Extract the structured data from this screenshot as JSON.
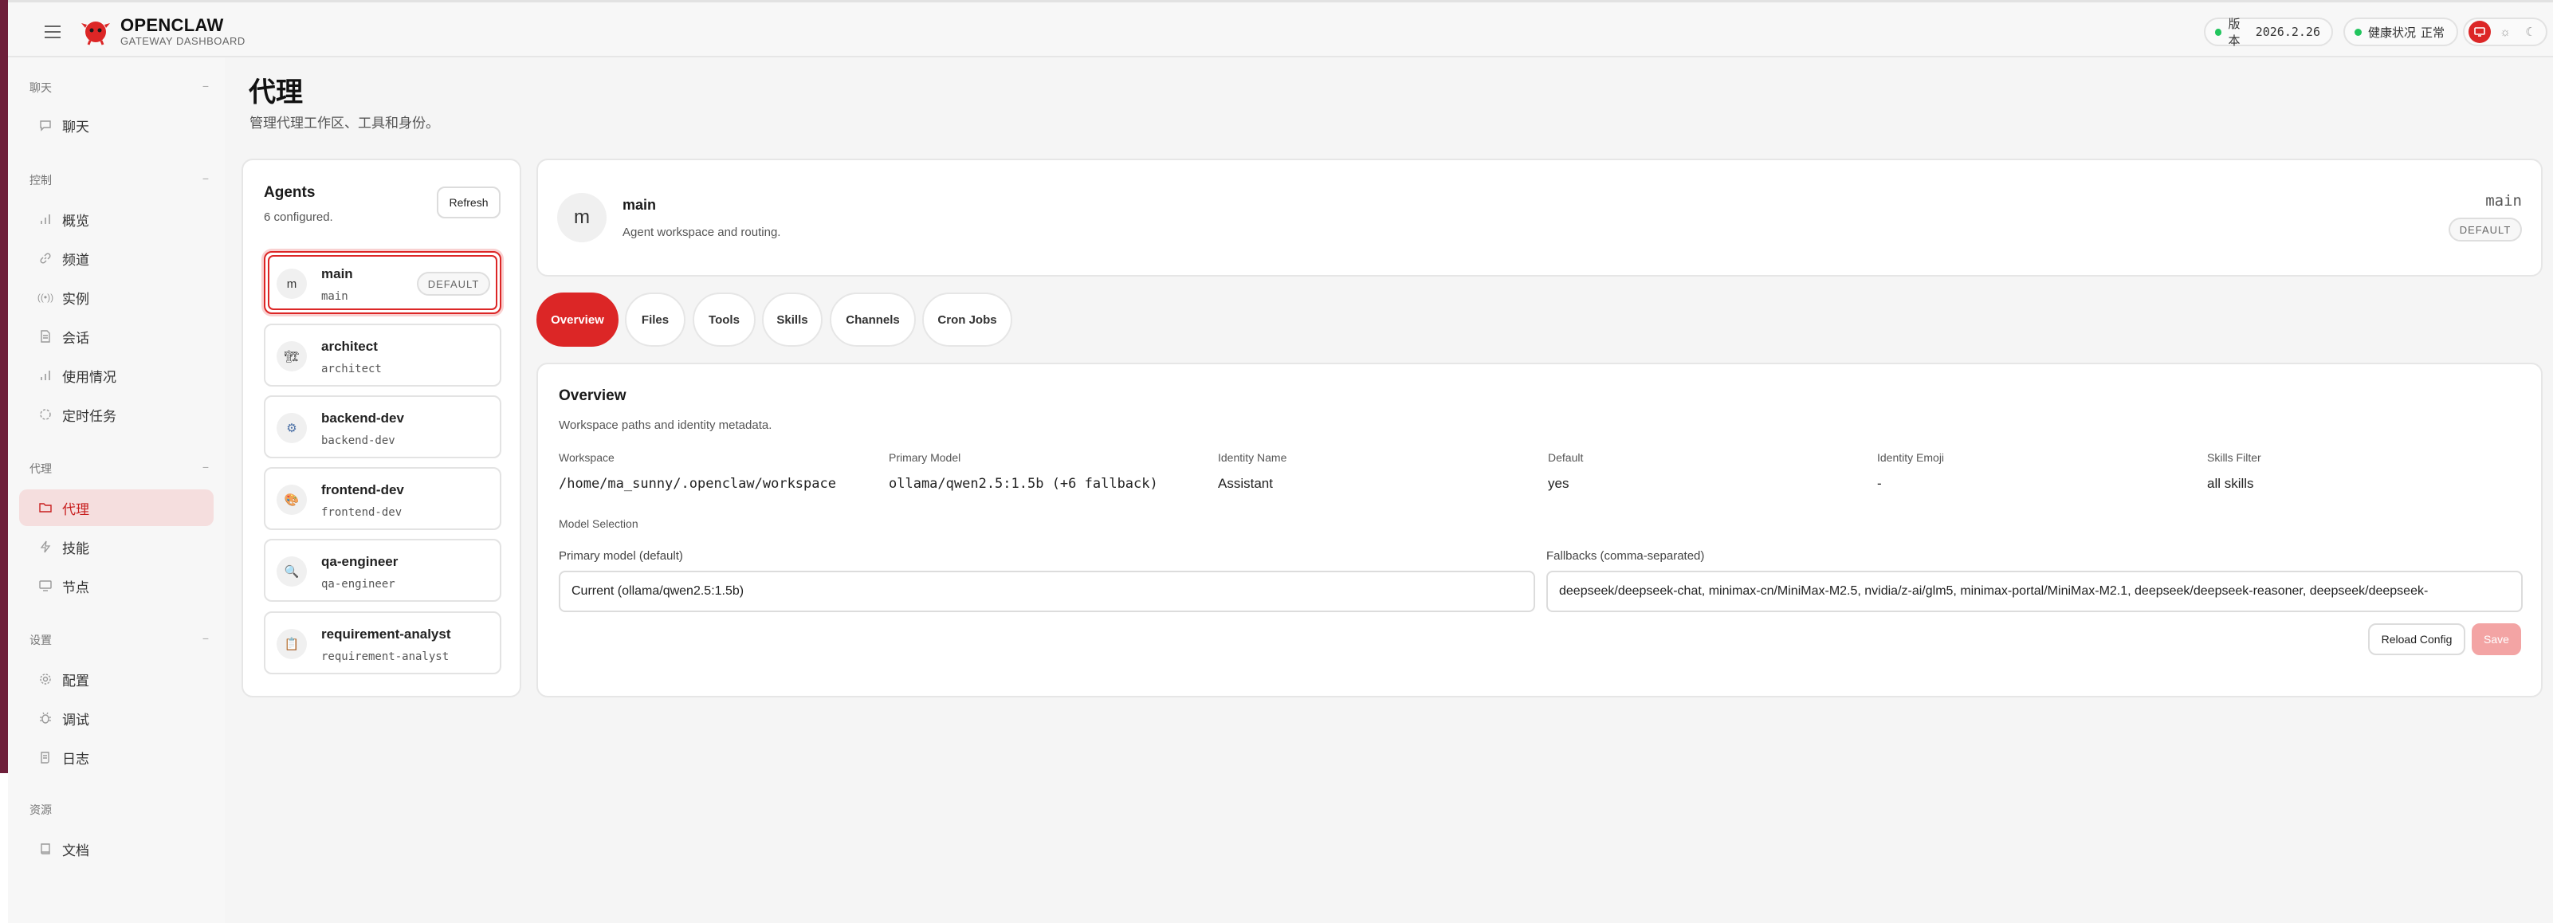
{
  "brand": {
    "name": "OPENCLAW",
    "subtitle": "GATEWAY DASHBOARD"
  },
  "topbar": {
    "version_label": "版本",
    "version_value": "2026.2.26",
    "health_label": "健康状况",
    "health_value": "正常",
    "status_color": "#22c55e",
    "accent_color": "#dc2626"
  },
  "sidebar": {
    "sections": [
      {
        "title": "聊天",
        "items": [
          {
            "label": "聊天",
            "icon": "chat-icon"
          }
        ]
      },
      {
        "title": "控制",
        "items": [
          {
            "label": "概览",
            "icon": "bar-chart-icon"
          },
          {
            "label": "频道",
            "icon": "link-icon"
          },
          {
            "label": "实例",
            "icon": "radio-icon"
          },
          {
            "label": "会话",
            "icon": "document-icon"
          },
          {
            "label": "使用情况",
            "icon": "bar-chart-icon"
          },
          {
            "label": "定时任务",
            "icon": "loader-icon"
          }
        ]
      },
      {
        "title": "代理",
        "items": [
          {
            "label": "代理",
            "icon": "folder-icon",
            "active": true
          },
          {
            "label": "技能",
            "icon": "zap-icon"
          },
          {
            "label": "节点",
            "icon": "monitor-icon"
          }
        ]
      },
      {
        "title": "设置",
        "items": [
          {
            "label": "配置",
            "icon": "gear-icon"
          },
          {
            "label": "调试",
            "icon": "bug-icon"
          },
          {
            "label": "日志",
            "icon": "scroll-icon"
          }
        ]
      },
      {
        "title": "资源",
        "items": [
          {
            "label": "文档",
            "icon": "book-icon"
          }
        ]
      }
    ]
  },
  "page": {
    "title": "代理",
    "subtitle": "管理代理工作区、工具和身份。"
  },
  "agents": {
    "title": "Agents",
    "count_text": "6 configured.",
    "refresh_label": "Refresh",
    "default_badge": "DEFAULT",
    "list": [
      {
        "name": "main",
        "id": "main",
        "avatar": "m",
        "default": true,
        "selected": true
      },
      {
        "name": "architect",
        "id": "architect",
        "avatar": "🏗"
      },
      {
        "name": "backend-dev",
        "id": "backend-dev",
        "avatar": "⚙"
      },
      {
        "name": "frontend-dev",
        "id": "frontend-dev",
        "avatar": "🎨"
      },
      {
        "name": "qa-engineer",
        "id": "qa-engineer",
        "avatar": "🔍"
      },
      {
        "name": "requirement-analyst",
        "id": "requirement-analyst",
        "avatar": "📋"
      }
    ]
  },
  "agent_header": {
    "avatar": "m",
    "name": "main",
    "subtitle": "Agent workspace and routing.",
    "id": "main",
    "badge": "DEFAULT"
  },
  "tabs": [
    "Overview",
    "Files",
    "Tools",
    "Skills",
    "Channels",
    "Cron Jobs"
  ],
  "overview": {
    "title": "Overview",
    "subtitle": "Workspace paths and identity metadata.",
    "fields": [
      {
        "label": "Workspace",
        "value": "/home/ma_sunny/.openclaw/workspace"
      },
      {
        "label": "Primary Model",
        "value": "ollama/qwen2.5:1.5b (+6 fallback)"
      },
      {
        "label": "Identity Name",
        "value": "Assistant"
      },
      {
        "label": "Default",
        "value": "yes"
      },
      {
        "label": "Identity Emoji",
        "value": "-"
      },
      {
        "label": "Skills Filter",
        "value": "all skills"
      }
    ],
    "model_selection_label": "Model Selection",
    "primary_model_label": "Primary model (default)",
    "primary_model_value": "Current (ollama/qwen2.5:1.5b)",
    "fallbacks_label": "Fallbacks (comma-separated)",
    "fallbacks_value": "deepseek/deepseek-chat, minimax-cn/MiniMax-M2.5, nvidia/z-ai/glm5, minimax-portal/MiniMax-M2.1, deepseek/deepseek-reasoner, deepseek/deepseek-",
    "reload_label": "Reload Config",
    "save_label": "Save"
  }
}
